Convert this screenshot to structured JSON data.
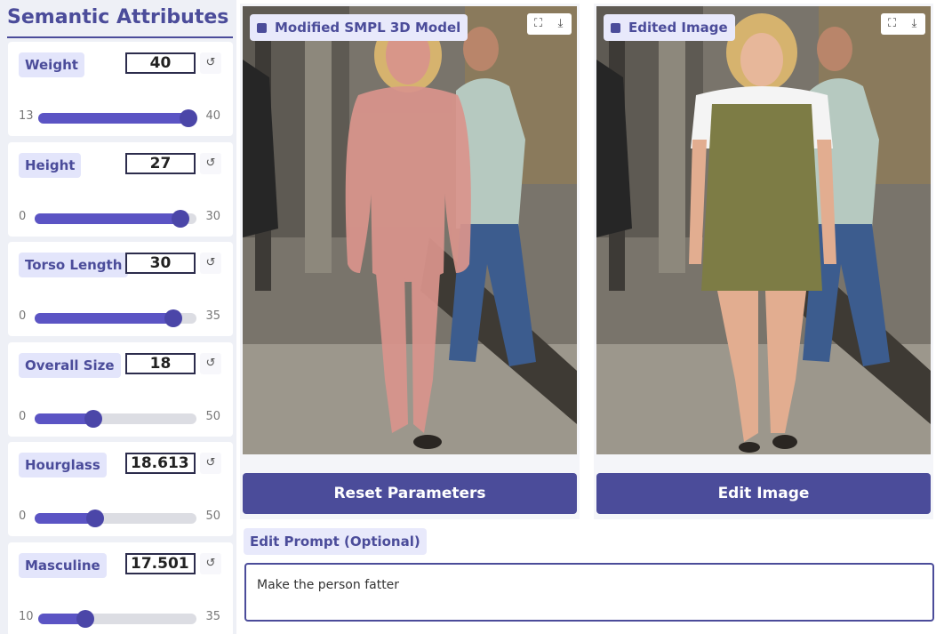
{
  "sidebar": {
    "title": "Semantic Attributes",
    "reset_icon": "↺",
    "params": [
      {
        "label": "Weight",
        "value": "40",
        "min": "13",
        "max": "40",
        "level": 1.0
      },
      {
        "label": "Height",
        "value": "27",
        "min": "0",
        "max": "30",
        "level": 0.9
      },
      {
        "label": "Torso Length",
        "value": "30",
        "min": "0",
        "max": "35",
        "level": 0.857
      },
      {
        "label": "Overall Size",
        "value": "18",
        "min": "0",
        "max": "50",
        "level": 0.36
      },
      {
        "label": "Hourglass",
        "value": "18.613",
        "min": "0",
        "max": "50",
        "level": 0.372
      },
      {
        "label": "Masculine",
        "value": "17.501",
        "min": "10",
        "max": "35",
        "level": 0.3
      }
    ]
  },
  "panels": {
    "left": {
      "label": "Modified SMPL 3D Model",
      "button": "Reset Parameters",
      "fullscreen_icon": "⛶",
      "download_icon": "⤓"
    },
    "right": {
      "label": "Edited Image",
      "button": "Edit Image",
      "fullscreen_icon": "⛶",
      "download_icon": "⤓"
    }
  },
  "prompt": {
    "label": "Edit Prompt (Optional)",
    "value": "Make the person fatter"
  },
  "colors": {
    "accent": "#4b4c9a",
    "slider_fill": "#5b54c4",
    "mesh": "#d9948c",
    "dress": "#7d7c45"
  }
}
